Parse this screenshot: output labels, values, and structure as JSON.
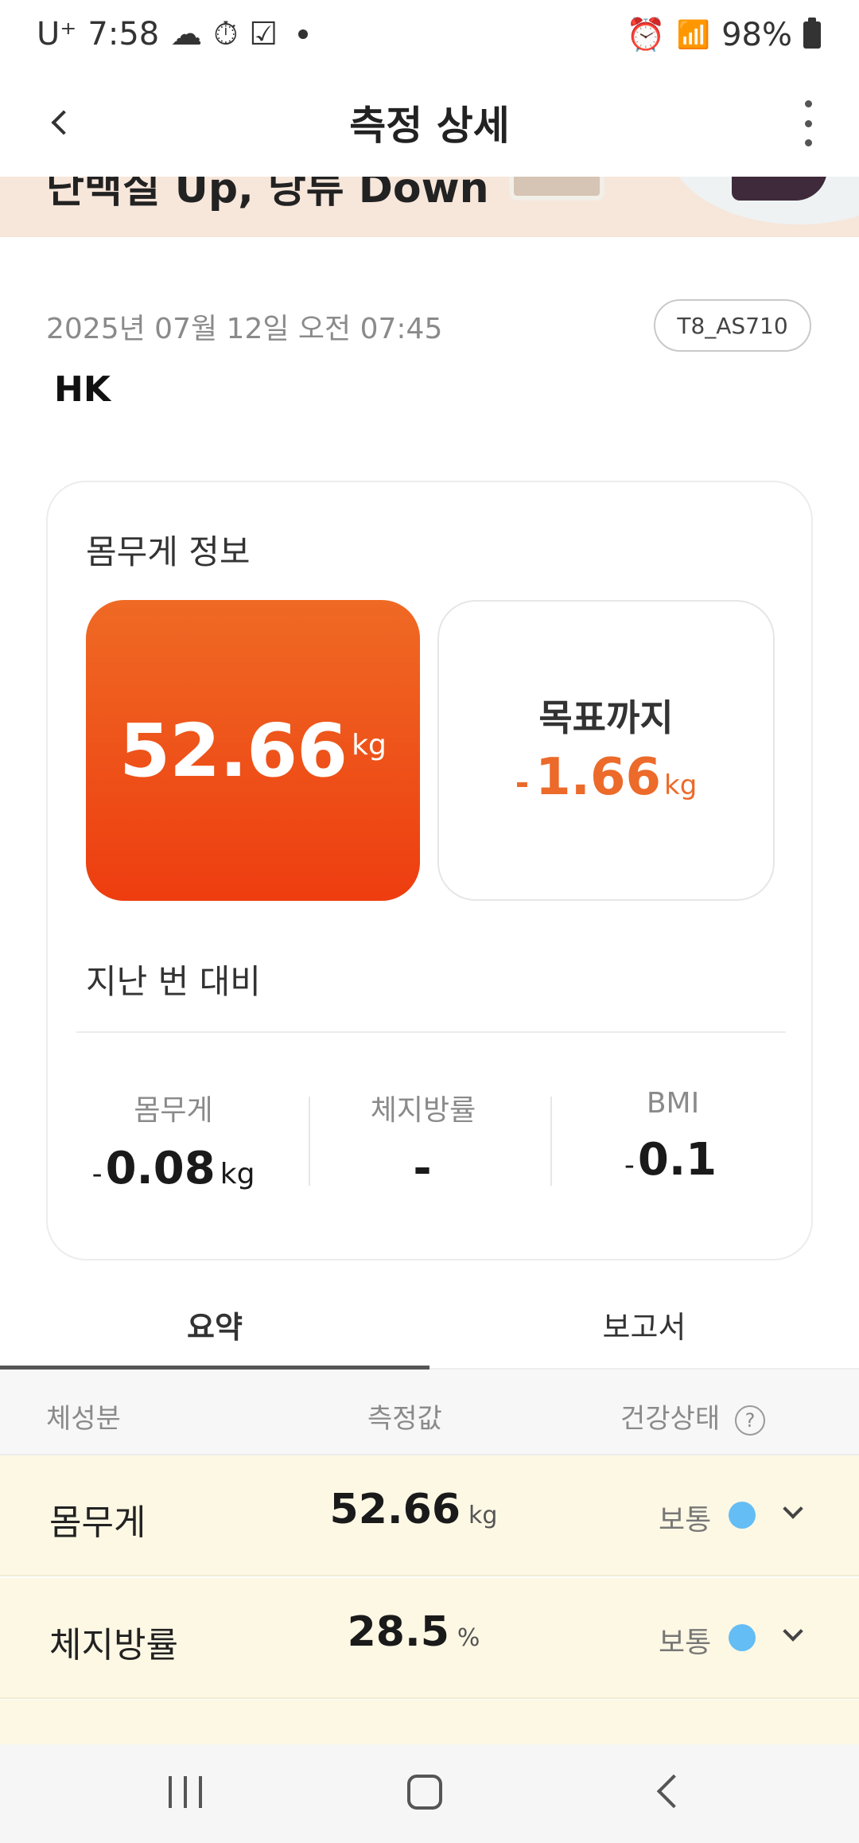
{
  "status_bar": {
    "carrier": "U⁺",
    "time": "7:58",
    "battery": "98%"
  },
  "app_bar": {
    "title": "측정 상세"
  },
  "banner": {
    "text": "단백질 Up, 당류 Down"
  },
  "measurement": {
    "date": "2025년 07월 12일 오전 07:45",
    "device": "T8_AS710",
    "user": "HK"
  },
  "weight_card": {
    "title": "몸무게 정보",
    "weight_value": "52.66",
    "weight_unit": "kg",
    "goal_label": "목표까지",
    "goal_sign": "-",
    "goal_value": "1.66",
    "goal_unit": "kg"
  },
  "comparison": {
    "title": "지난 번 대비",
    "items": [
      {
        "label": "몸무게",
        "sign": "-",
        "value": "0.08",
        "unit": "kg"
      },
      {
        "label": "체지방률",
        "sign": "",
        "value": "-",
        "unit": ""
      },
      {
        "label": "BMI",
        "sign": "-",
        "value": "0.1",
        "unit": ""
      }
    ]
  },
  "tabs": [
    {
      "label": "요약",
      "active": true
    },
    {
      "label": "보고서",
      "active": false
    }
  ],
  "table": {
    "headers": [
      "체성분",
      "측정값",
      "건강상태"
    ],
    "rows": [
      {
        "name": "몸무게",
        "value": "52.66",
        "unit": "kg",
        "status": "보통",
        "status_color": "#64bdf4"
      },
      {
        "name": "체지방률",
        "value": "28.5",
        "unit": "%",
        "status": "보통",
        "status_color": "#64bdf4"
      }
    ]
  },
  "colors": {
    "accent_orange": "#ee4c16",
    "goal_orange": "#ec6a2a",
    "status_normal": "#64bdf4",
    "row_background": "#fdf8e4"
  }
}
